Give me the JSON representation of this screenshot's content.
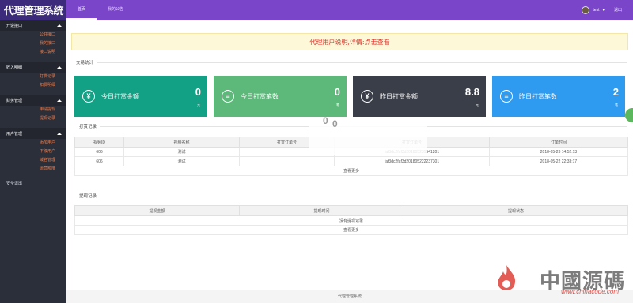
{
  "app": {
    "title": "代理管理系统"
  },
  "topnav": {
    "tabs": [
      {
        "label": "首页"
      },
      {
        "label": "我的公告"
      }
    ]
  },
  "user": {
    "name": "test",
    "logout_label": "退出"
  },
  "sidebar": {
    "groups": [
      {
        "title": "开设接口",
        "items": [
          "公共接口",
          "我的接口",
          "接口说明"
        ]
      },
      {
        "title": "收入明细",
        "items": [
          "打赏记录",
          "扣费明细"
        ]
      },
      {
        "title": "财务管理",
        "items": [
          "申请提现",
          "提现记录"
        ]
      },
      {
        "title": "用户管理",
        "items": [
          "添加用户",
          "下级用户",
          "域名管理",
          "运营额度"
        ]
      }
    ],
    "extra": "安全退出"
  },
  "notice": {
    "text": "代理用户说明,详情:点击查看"
  },
  "stats": {
    "section_title": "交易统计",
    "cards": [
      {
        "label": "今日打赏金额",
        "value": "0",
        "unit": "元",
        "icon": "yen-icon",
        "color": "#13a185"
      },
      {
        "label": "今日打赏笔数",
        "value": "0",
        "unit": "笔",
        "icon": "list-icon",
        "color": "#5cb97a"
      },
      {
        "label": "昨日打赏金额",
        "value": "8.8",
        "unit": "元",
        "icon": "yen-icon",
        "color": "#3a3e48"
      },
      {
        "label": "昨日打赏笔数",
        "value": "2",
        "unit": "笔",
        "icon": "list-icon",
        "color": "#2e9bf0"
      }
    ]
  },
  "orders": {
    "section_title": "打赏记录",
    "columns": [
      "视频ID",
      "视频名称",
      "打赏订单号",
      "打赏订单号",
      "订单时间"
    ],
    "rows": [
      [
        "606",
        "测试",
        "",
        "faf3dc2faf3d201805231541201",
        "2018-05-23 14:52:13"
      ],
      [
        "606",
        "测试",
        "",
        "faf3dc2faf3d201805222237301",
        "2018-05-22 22:33:17"
      ]
    ],
    "more_label": "查看更多"
  },
  "withdrawals": {
    "section_title": "提现记录",
    "columns": [
      "提现金额",
      "提现时间",
      "提现状态"
    ],
    "empty_label": "没有提现记录",
    "more_label": "查看更多"
  },
  "floating": {
    "a": "0",
    "b": "0"
  },
  "footer": {
    "text": "代理管理系统"
  },
  "watermark": {
    "cn": "中國源碼",
    "url": "www.chinacode.com"
  }
}
